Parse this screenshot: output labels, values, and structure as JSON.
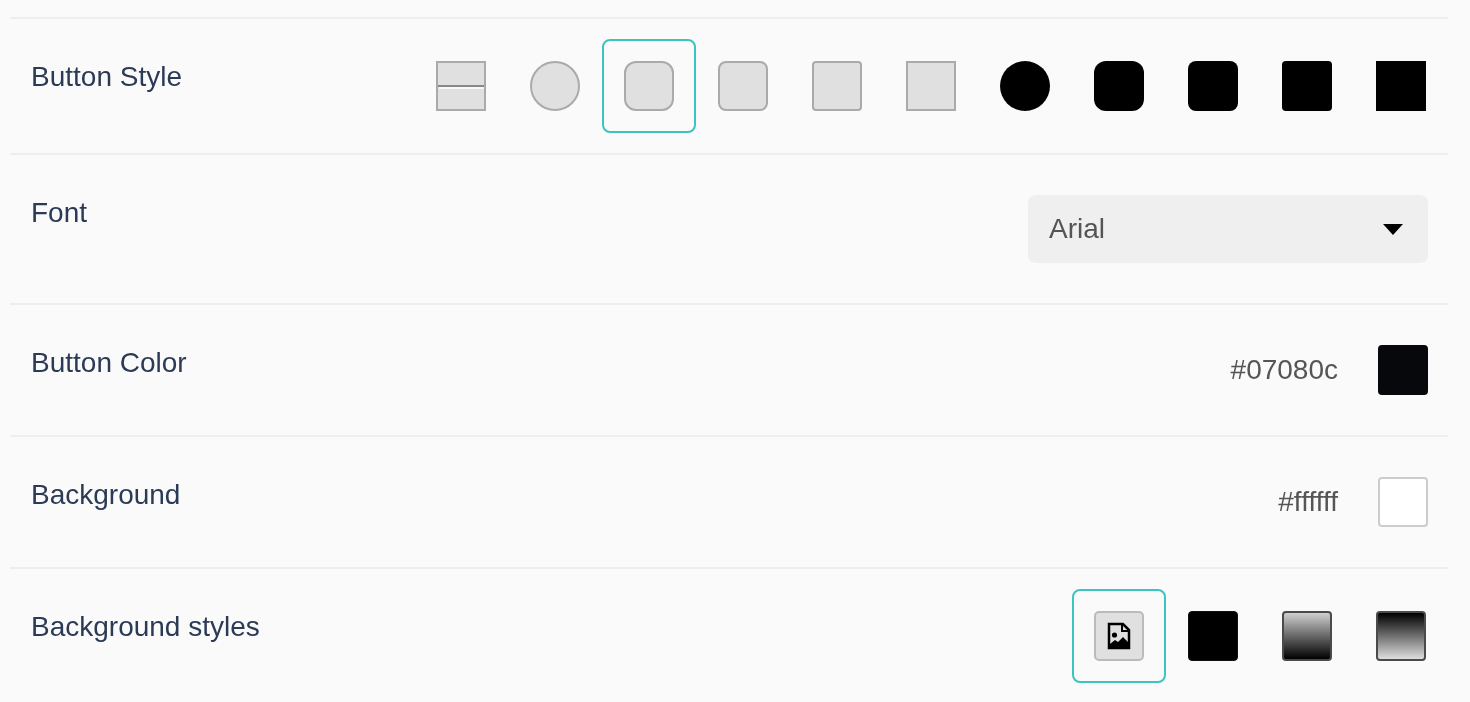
{
  "settings": [
    {
      "kind": "shapes",
      "label": "Button Style",
      "options": [
        {
          "kind": "bar",
          "filled": false,
          "selected": false
        },
        {
          "kind": "circle",
          "filled": false,
          "selected": false
        },
        {
          "kind": "round",
          "filled": false,
          "selected": true
        },
        {
          "kind": "soft",
          "filled": false,
          "selected": false
        },
        {
          "kind": "slight",
          "filled": false,
          "selected": false
        },
        {
          "kind": "square",
          "filled": false,
          "selected": false
        },
        {
          "kind": "circle",
          "filled": true,
          "selected": false
        },
        {
          "kind": "round",
          "filled": true,
          "selected": false
        },
        {
          "kind": "soft",
          "filled": true,
          "selected": false
        },
        {
          "kind": "slight",
          "filled": true,
          "selected": false
        },
        {
          "kind": "square",
          "filled": true,
          "selected": false
        }
      ]
    },
    {
      "kind": "select",
      "label": "Font",
      "value": "Arial"
    },
    {
      "kind": "color",
      "label": "Button Color",
      "value": "#07080c",
      "color": "#07080c"
    },
    {
      "kind": "color",
      "label": "Background",
      "value": "#ffffff",
      "color": "#ffffff"
    },
    {
      "kind": "backgrounds",
      "label": "Background styles",
      "options": [
        {
          "kind": "image",
          "selected": true
        },
        {
          "kind": "solid",
          "selected": false
        },
        {
          "kind": "gradient",
          "selected": false
        },
        {
          "kind": "inverse",
          "selected": false
        }
      ]
    }
  ]
}
